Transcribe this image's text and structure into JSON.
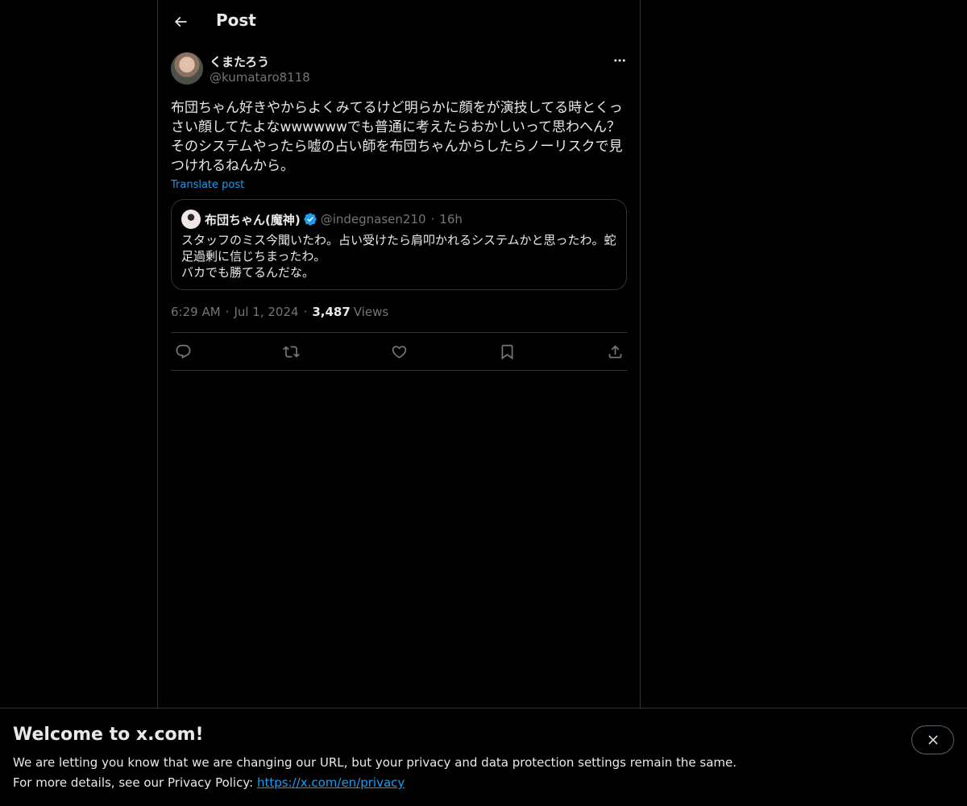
{
  "header": {
    "title": "Post",
    "back_icon": "arrow-left-icon"
  },
  "post": {
    "author_name": "くまたろう",
    "author_handle": "@kumataro8118",
    "text": "布団ちゃん好きやからよくみてるけど明らかに顔をが演技してる時とくっさい顔してたよなwwwwwwでも普通に考えたらおかしいって思わへん？そのシステムやったら嘘の占い師を布団ちゃんからしたらノーリスクで見つけれるねんから。",
    "translate_label": "Translate post",
    "quote": {
      "author_name": "布団ちゃん(魔神)",
      "author_handle": "@indegnasen210",
      "dot": "·",
      "time": "16h",
      "text": "スタッフのミス今聞いたわ。占い受けたら肩叩かれるシステムかと思ったわ。蛇足過剰に信じちまったわ。\nバカでも勝てるんだな。"
    },
    "time": "6:29 AM",
    "date": "Jul 1, 2024",
    "views_count": "3,487",
    "views_label": "Views",
    "dot": "·"
  },
  "actions": [
    "reply-icon",
    "repost-icon",
    "like-icon",
    "bookmark-icon",
    "share-icon"
  ],
  "banner": {
    "title": "Welcome to x.com!",
    "line1": "We are letting you know that we are changing our URL, but your privacy and data protection settings remain the same.",
    "line2_prefix": "For more details, see our Privacy Policy: ",
    "link": "https://x.com/en/privacy"
  },
  "colors": {
    "background": "#000000",
    "text": "#e7e9ea",
    "secondary": "#71767b",
    "accent": "#1d9bf0",
    "border": "#2f3336"
  }
}
